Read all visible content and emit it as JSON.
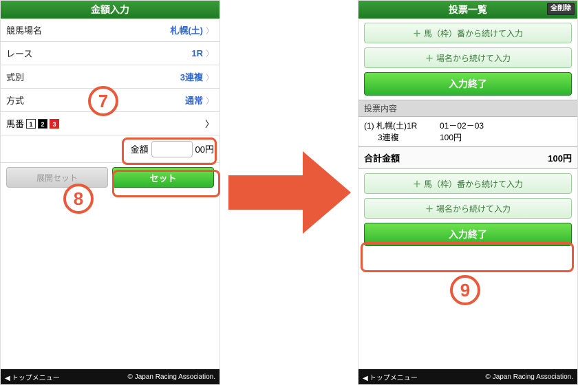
{
  "left": {
    "title": "金額入力",
    "rows": {
      "track_label": "競馬場名",
      "track_val": "札幌(土)",
      "race_label": "レース",
      "race_val": "1R",
      "type_label": "式別",
      "type_val": "3連複",
      "method_label": "方式",
      "method_val": "通常",
      "uma_label": "馬番"
    },
    "uma_numbers": [
      "1",
      "2",
      "3"
    ],
    "amount_label": "金額",
    "amount_suffix": "00円",
    "expand_btn": "展開セット",
    "set_btn": "セット"
  },
  "right": {
    "title": "投票一覧",
    "delete_all": "全削除",
    "btn_uma": "馬（枠）番から続けて入力",
    "btn_place": "場名から続けて入力",
    "btn_finish": "入力終了",
    "section_head": "投票内容",
    "ticket": {
      "idx": "(1)",
      "track": "札幌(土)1R",
      "type": "3連複",
      "combo": "01－02－03",
      "amount": "100円"
    },
    "total_label": "合計金額",
    "total_val": "100円"
  },
  "footer": {
    "top_menu": "トップメニュー",
    "copyright": "© Japan Racing Association."
  },
  "annotations": {
    "n7": "7",
    "n8": "8",
    "n9": "9"
  }
}
